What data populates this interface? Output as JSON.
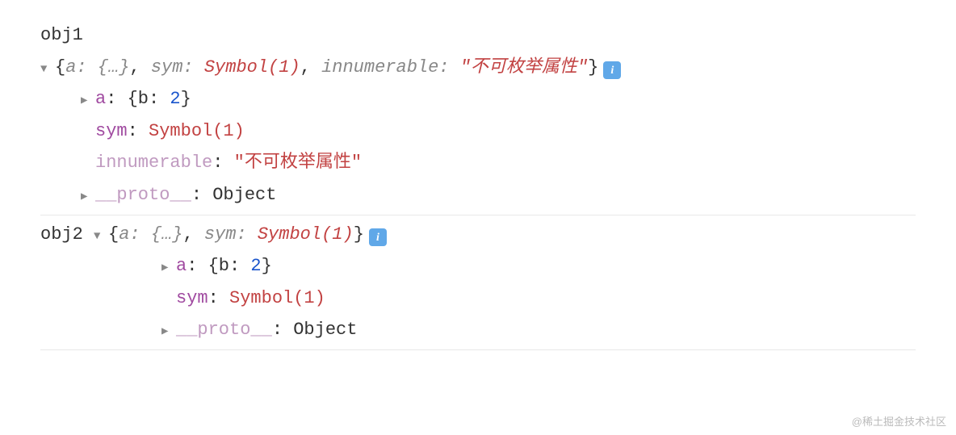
{
  "obj1": {
    "label": "obj1",
    "preview": {
      "open": "{",
      "k1": "a:",
      "v1": " {…}",
      "sep1": ", ",
      "k2": "sym:",
      "v2": " Symbol(1)",
      "sep2": ", ",
      "k3": "innumerable:",
      "q": " \"",
      "v3": "不可枚举属性",
      "q2": "\"",
      "close": "}"
    },
    "prop_a": {
      "key": "a",
      "val_open": "{b: ",
      "val_num": "2",
      "val_close": "}"
    },
    "prop_sym": {
      "key": "sym",
      "val": "Symbol(1)"
    },
    "prop_innum": {
      "key": "innumerable",
      "q1": "\"",
      "val": "不可枚举属性",
      "q2": "\""
    },
    "proto": {
      "key": "__proto__",
      "val": "Object"
    }
  },
  "obj2": {
    "label": "obj2",
    "preview": {
      "open": "{",
      "k1": "a:",
      "v1": " {…}",
      "sep1": ", ",
      "k2": "sym:",
      "v2": " Symbol(1)",
      "close": "}"
    },
    "prop_a": {
      "key": "a",
      "val_open": "{b: ",
      "val_num": "2",
      "val_close": "}"
    },
    "prop_sym": {
      "key": "sym",
      "val": "Symbol(1)"
    },
    "proto": {
      "key": "__proto__",
      "val": "Object"
    }
  },
  "info_glyph": "i",
  "watermark": "@稀土掘金技术社区"
}
